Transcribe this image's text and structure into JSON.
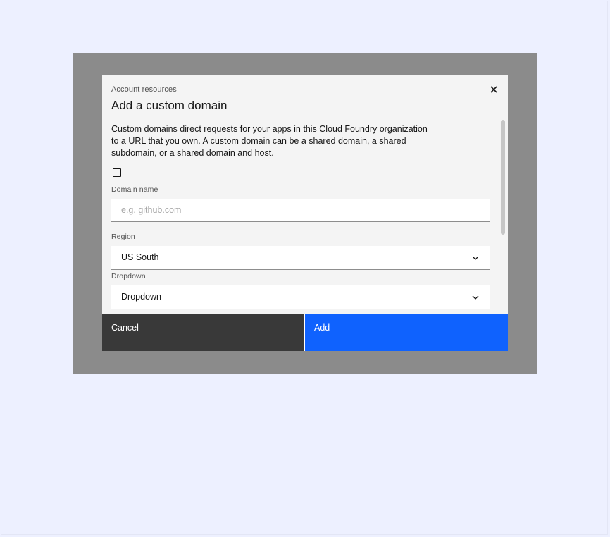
{
  "modal": {
    "label": "Account resources",
    "title": "Add a custom domain",
    "description": "Custom domains direct requests for your apps in this Cloud Foundry organization to a URL that you own. A custom domain can be a shared domain, a shared subdomain, or a shared domain and host.",
    "checkbox_checked": false
  },
  "fields": {
    "domain_name": {
      "label": "Domain name",
      "value": "",
      "placeholder": "e.g. github.com"
    },
    "region": {
      "label": "Region",
      "value": "US South"
    },
    "dropdown": {
      "label": "Dropdown",
      "value": "Dropdown"
    }
  },
  "footer": {
    "cancel_label": "Cancel",
    "add_label": "Add"
  },
  "icons": {
    "close": "close-icon",
    "chevron": "chevron-down-icon"
  },
  "colors": {
    "page_background": "#edf0ff",
    "overlay": "#8b8b8b",
    "modal_background": "#f4f4f4",
    "primary": "#0f62fe",
    "secondary": "#393939"
  }
}
